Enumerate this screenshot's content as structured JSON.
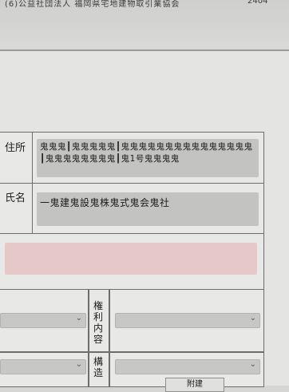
{
  "header": {
    "association": "(6)公益社団法人 福岡県宅地建物取引業協会",
    "code": "2404"
  },
  "form": {
    "address": {
      "label": "住所",
      "value": "鬼鬼鬼┃鬼鬼鬼鬼鬼┃鬼鬼鬼鬼鬼鬼鬼鬼鬼鬼鬼鬼鬼鬼鬼┃鬼鬼鬼鬼鬼鬼鬼鬼┃鬼1号鬼鬼鬼鬼"
    },
    "name": {
      "label": "氏名",
      "value": "一鬼建鬼設鬼株鬼式鬼会鬼社"
    },
    "lower": {
      "rights_label": "権利内容",
      "structure_label": "構造",
      "attached_label": "附建"
    },
    "dropdown_icon": "chevron-down-icon"
  }
}
